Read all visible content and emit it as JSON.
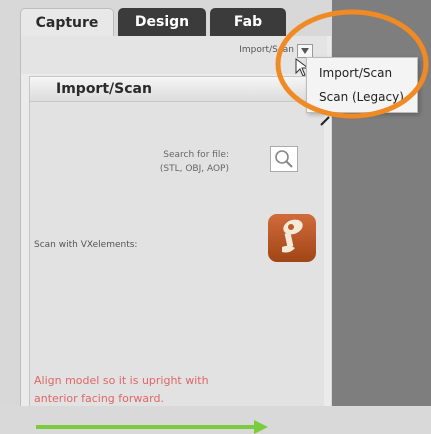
{
  "tabs": [
    {
      "label": "Capture"
    },
    {
      "label": "Design"
    },
    {
      "label": "Fab"
    }
  ],
  "top": {
    "dropdown_label": "Import/Scan"
  },
  "menu": {
    "items": [
      {
        "label": "Import/Scan"
      },
      {
        "label": "Scan (Legacy)"
      }
    ]
  },
  "panel": {
    "title": "Import/Scan",
    "search_label": "Search for file:",
    "search_formats": "(STL, OBJ, AOP)",
    "scan_label": "Scan with VXelements:",
    "align_line1": "Align model so it is upright with",
    "align_line2": "anterior facing forward."
  },
  "colors": {
    "highlight_orange": "#f08a24",
    "instruction_text": "#e06666",
    "arrow_green": "#7acb3d",
    "tab_dark": "#3b3b3b"
  },
  "icons": [
    "search-icon",
    "vxelements-scanner-icon",
    "chevron-down-icon",
    "mouse-cursor-icon",
    "green-arrow-icon"
  ]
}
